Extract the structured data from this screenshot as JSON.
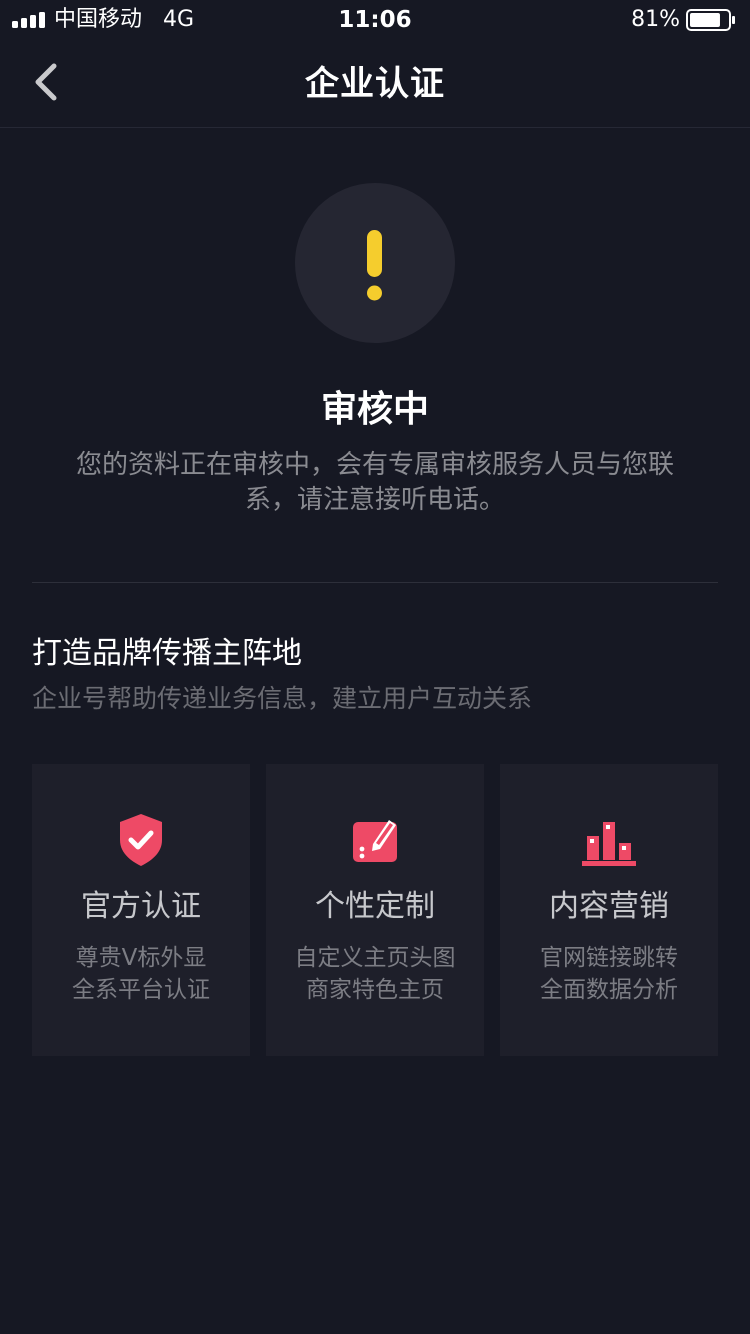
{
  "status_bar": {
    "carrier": "中国移动",
    "network": "4G",
    "time": "11:06",
    "battery": "81%",
    "battery_level": 0.81
  },
  "nav": {
    "title": "企业认证",
    "back_icon": "chevron-left-icon"
  },
  "review": {
    "icon": "exclamation-icon",
    "icon_color": "#f5cd2d",
    "title": "审核中",
    "description": "您的资料正在审核中，会有专属审核服务人员与您联系，请注意接听电话。"
  },
  "promo": {
    "title": "打造品牌传播主阵地",
    "subtitle": "企业号帮助传递业务信息，建立用户互动关系"
  },
  "features": [
    {
      "icon": "shield-check-icon",
      "title": "官方认证",
      "line1": "尊贵V标外显",
      "line2": "全系平台认证"
    },
    {
      "icon": "custom-edit-icon",
      "title": "个性定制",
      "line1": "自定义主页头图",
      "line2": "商家特色主页"
    },
    {
      "icon": "bar-chart-icon",
      "title": "内容营销",
      "line1": "官网链接跳转",
      "line2": "全面数据分析"
    }
  ],
  "colors": {
    "background": "#161823",
    "accent": "#fe2c55",
    "icon_pink": "#ee4a66",
    "warning": "#f5cd2d"
  }
}
